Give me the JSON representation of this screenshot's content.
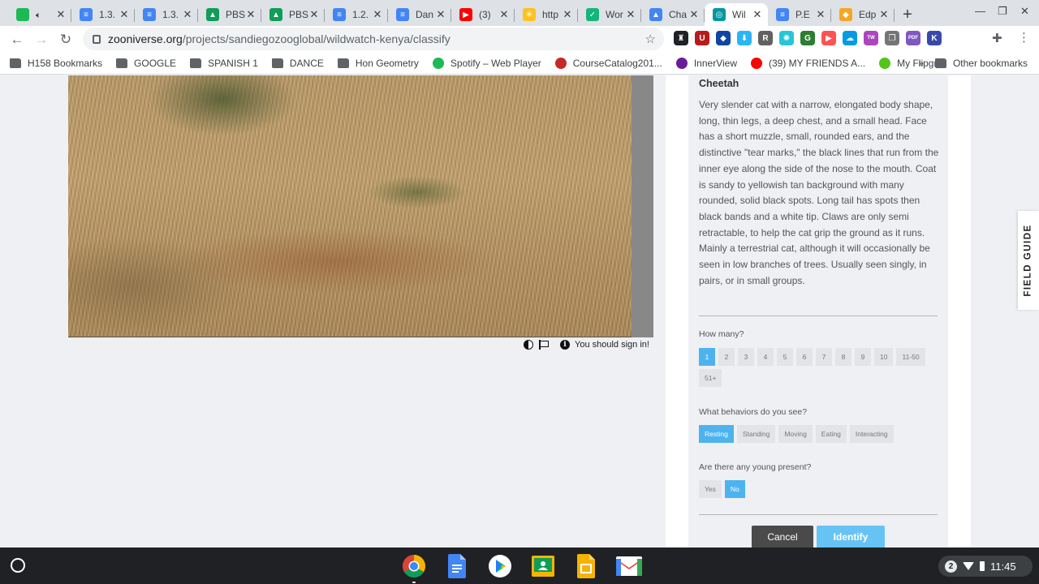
{
  "browser": {
    "tabs": [
      {
        "title": "",
        "favicon_color": "#1db954",
        "favicon_glyph": "",
        "audio": true
      },
      {
        "title": "1.3.",
        "favicon_color": "#4285f4",
        "favicon_glyph": "≡"
      },
      {
        "title": "1.3.",
        "favicon_color": "#4285f4",
        "favicon_glyph": "≡"
      },
      {
        "title": "PBS",
        "favicon_color": "#0f9d58",
        "favicon_glyph": "▲"
      },
      {
        "title": "PBS",
        "favicon_color": "#0f9d58",
        "favicon_glyph": "▲"
      },
      {
        "title": "1.2.",
        "favicon_color": "#4285f4",
        "favicon_glyph": "≡"
      },
      {
        "title": "Dan",
        "favicon_color": "#4285f4",
        "favicon_glyph": "≡"
      },
      {
        "title": "(3) ",
        "favicon_color": "#ff0000",
        "favicon_glyph": "▶"
      },
      {
        "title": "http",
        "favicon_color": "#ffc220",
        "favicon_glyph": "✳"
      },
      {
        "title": "Wor",
        "favicon_color": "#13b57d",
        "favicon_glyph": "✓"
      },
      {
        "title": "Cha",
        "favicon_color": "#4285f4",
        "favicon_glyph": "▲"
      },
      {
        "title": "Wil",
        "favicon_color": "#00979d",
        "favicon_glyph": "◎",
        "active": true
      },
      {
        "title": "P.E",
        "favicon_color": "#4285f4",
        "favicon_glyph": "≡"
      },
      {
        "title": "Edp",
        "favicon_color": "#f5a623",
        "favicon_glyph": "◆"
      }
    ],
    "url_host": "zooniverse.org",
    "url_path": "/projects/sandiegozooglobal/wildwatch-kenya/classify",
    "extensions": [
      {
        "icon": "ghost-icon",
        "color": "#202124",
        "glyph": "♜"
      },
      {
        "icon": "shield-icon",
        "color": "#b71c1c",
        "glyph": "U"
      },
      {
        "icon": "bolt-icon",
        "color": "#0d47a1",
        "glyph": "◆"
      },
      {
        "icon": "download-icon",
        "color": "#29b6f6",
        "glyph": "⬇"
      },
      {
        "icon": "reader-icon",
        "color": "#616161",
        "glyph": "R"
      },
      {
        "icon": "globe-icon",
        "color": "#26c6da",
        "glyph": "✺"
      },
      {
        "icon": "grammar-icon",
        "color": "#2e7d32",
        "glyph": "G"
      },
      {
        "icon": "screencast-icon",
        "color": "#ff5252",
        "glyph": "▶"
      },
      {
        "icon": "cloud-icon",
        "color": "#039be5",
        "glyph": "☁"
      },
      {
        "icon": "tw-icon",
        "color": "#ab47bc",
        "glyph": "TW"
      },
      {
        "icon": "copy-icon",
        "color": "#757575",
        "glyph": "❐"
      },
      {
        "icon": "pdf-icon",
        "color": "#7e57c2",
        "glyph": "PDF"
      },
      {
        "icon": "k-icon",
        "color": "#3949ab",
        "glyph": "K"
      }
    ],
    "bookmarks": [
      {
        "label": "H158 Bookmarks",
        "icon": "bookmark-folder-icon",
        "color": "#5f6368"
      },
      {
        "label": "GOOGLE",
        "icon": "folder-icon",
        "color": "#5f6368"
      },
      {
        "label": "SPANISH 1",
        "icon": "folder-icon",
        "color": "#5f6368"
      },
      {
        "label": "DANCE",
        "icon": "folder-icon",
        "color": "#5f6368"
      },
      {
        "label": "Hon Geometry",
        "icon": "folder-icon",
        "color": "#5f6368"
      },
      {
        "label": "Spotify – Web Player",
        "icon": "spotify-icon",
        "color": "#1db954"
      },
      {
        "label": "CourseCatalog201...",
        "icon": "catalog-icon",
        "color": "#c62828"
      },
      {
        "label": "InnerView",
        "icon": "innerview-icon",
        "color": "#6a1b9a"
      },
      {
        "label": "(39) MY FRIENDS A...",
        "icon": "youtube-icon",
        "color": "#ff0000"
      },
      {
        "label": "My Flipgrid",
        "icon": "flipgrid-icon",
        "color": "#52c41a"
      }
    ],
    "overflow_label": "»",
    "other_bookmarks": "Other bookmarks"
  },
  "subject": {
    "sign_in_notice": "You should sign in!"
  },
  "task": {
    "choice_name": "Cheetah",
    "choice_description": "Very slender cat with a narrow, elongated body shape, long, thin legs, a deep chest, and a small head. Face has a short muzzle, small, rounded ears, and the distinctive \"tear marks,\" the black lines that run from the inner eye along the side of the nose to the mouth. Coat is sandy to yellowish tan background with many rounded, solid black spots. Long tail has spots then black bands and a white tip. Claws are only semi retractable, to help the cat grip the ground as it runs. Mainly a terrestrial cat, although it will occasionally be seen in low branches of trees. Usually seen singly, in pairs, or in small groups.",
    "questions": [
      {
        "label": "How many?",
        "options": [
          "1",
          "2",
          "3",
          "4",
          "5",
          "6",
          "7",
          "8",
          "9",
          "10",
          "11-50",
          "51+"
        ],
        "selected": "1"
      },
      {
        "label": "What behaviors do you see?",
        "options": [
          "Resting",
          "Standing",
          "Moving",
          "Eating",
          "Interacting"
        ],
        "selected": "Resting"
      },
      {
        "label": "Are there any young present?",
        "options": [
          "Yes",
          "No"
        ],
        "selected": "No"
      }
    ],
    "cancel_label": "Cancel",
    "identify_label": "Identify",
    "accent_color": "#4db3ef"
  },
  "field_guide_label": "FIELD GUIDE",
  "shelf": {
    "apps": [
      {
        "name": "chrome-icon"
      },
      {
        "name": "google-docs-icon"
      },
      {
        "name": "play-store-icon"
      },
      {
        "name": "google-classroom-icon"
      },
      {
        "name": "google-slides-icon"
      },
      {
        "name": "gmail-icon"
      }
    ],
    "notification_count": "2",
    "time": "11:45"
  }
}
